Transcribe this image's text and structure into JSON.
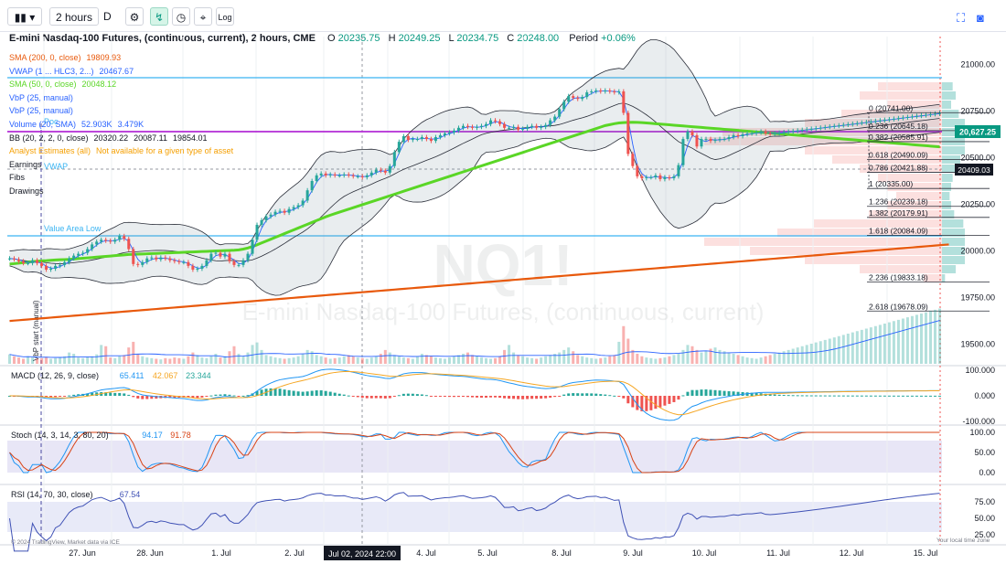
{
  "toolbar": {
    "interval": "2 hours",
    "chart_style_letter": "D",
    "log_label": "Log"
  },
  "header": {
    "title": "E-mini Nasdaq-100 Futures, (continuous, current), 2 hours, CME",
    "o_label": "O",
    "o_value": "20235.75",
    "h_label": "H",
    "h_value": "20249.25",
    "l_label": "L",
    "l_value": "20234.75",
    "c_label": "C",
    "c_value": "20248.00",
    "period_label": "Period",
    "period_change": "+0.06%"
  },
  "legend": [
    {
      "name": "SMA (200, 0, close)",
      "values": [
        "19809.93"
      ],
      "color": "#e8590c"
    },
    {
      "name": "VWAP (1 ... HLC3, 2...)",
      "values": [
        "20467.67"
      ],
      "color": "#2962ff"
    },
    {
      "name": "SMA (50, 0, close)",
      "values": [
        "20048.12"
      ],
      "color": "#5ad626"
    },
    {
      "name": "VbP (25, manual)",
      "values": [],
      "color": "#2962ff"
    },
    {
      "name": "VbP (25, manual)",
      "values": [],
      "color": "#2962ff"
    },
    {
      "name": "Volume (20, SMA)",
      "values": [
        "52.903K",
        "3.479K"
      ],
      "color": "#2962ff"
    },
    {
      "name": "BB (20, 2, 2, 0, close)",
      "values": [
        "20320.22",
        "20087.11",
        "19854.01"
      ],
      "color": "#131722"
    },
    {
      "name": "Analyst Estimates (all)",
      "values": [
        "Not available for a given type of asset"
      ],
      "color": "#f59f00"
    },
    {
      "name": "Earnings",
      "values": [],
      "color": "#131722"
    },
    {
      "name": "Fibs",
      "values": [],
      "color": "#131722"
    },
    {
      "name": "Drawings",
      "values": [],
      "color": "#131722"
    }
  ],
  "annotations": {
    "value_area_high": "Value Area High",
    "value_area_low": "Value Area Low",
    "poc": "Poc",
    "vwap_tag": "VWAP",
    "vbp_start": "VbP start (manual)",
    "watermark_symbol": "NQ1!",
    "watermark_name": "E-mini Nasdaq-100 Futures, (continuous, current)",
    "copyright": "© 2024 TradingView, Market data via ICE",
    "timezone": "Your local time zone",
    "crosshair_date": "Jul 02, 2024 22:00"
  },
  "price_tags": {
    "current": "20,627.25",
    "crosshair": "20409.03"
  },
  "colors": {
    "up": "#26a69a",
    "down": "#ef5350",
    "sma200": "#e8590c",
    "sma50": "#5ad626",
    "vwap": "#2962ff",
    "bb": "#2a2e39",
    "poc": "#b32bd4",
    "vah": "#3ab4f2",
    "macd": "#2196f3",
    "signal": "#f5a623",
    "stoch_k": "#2196f3",
    "stoch_d": "#d84315",
    "rsi": "#3f51b5"
  },
  "chart_data": [
    {
      "type": "line",
      "name": "price",
      "series_kind": "candlestick",
      "x_tick_labels": [
        "27. Jun",
        "28. Jun",
        "1. Jul",
        "2. Jul",
        "3. Jul",
        "4. Jul",
        "5. Jul",
        "8. Jul",
        "9. Jul",
        "10. Jul",
        "11. Jul",
        "12. Jul",
        "15. Jul"
      ],
      "y_tick_labels": [
        "21000.00",
        "20750.00",
        "20500.00",
        "20250.00",
        "20000.00",
        "19750.00",
        "19500.00"
      ],
      "ylim": [
        19410,
        21100
      ],
      "x": [
        0,
        1,
        2,
        3,
        4,
        5,
        6,
        7,
        8,
        9,
        10,
        11,
        12,
        13,
        14,
        15,
        16,
        17,
        18,
        19,
        20,
        21,
        22,
        23,
        24,
        25,
        26,
        27,
        28,
        29,
        30,
        31,
        32,
        33,
        34,
        35,
        36,
        37,
        38,
        39,
        40,
        41,
        42,
        43,
        44,
        45,
        46,
        47,
        48,
        49,
        50,
        51,
        52,
        53,
        54,
        55,
        56,
        57,
        58,
        59,
        60,
        61,
        62,
        63,
        64,
        65,
        66,
        67,
        68,
        69,
        70,
        71,
        72,
        73,
        74,
        75,
        76,
        77,
        78,
        79,
        80,
        81,
        82,
        83,
        84,
        85,
        86,
        87,
        88,
        89,
        90,
        91,
        92,
        93,
        94,
        95,
        96,
        97,
        98,
        99,
        100,
        101,
        102,
        103,
        104,
        105,
        106,
        107,
        108,
        109,
        110,
        111,
        112,
        113,
        114,
        115,
        116,
        117,
        118,
        119,
        120,
        121,
        122,
        123,
        124,
        125,
        126,
        127,
        128,
        129,
        130,
        131,
        132,
        133,
        134,
        135,
        136,
        137,
        138,
        139,
        140,
        141,
        142,
        143,
        144,
        145,
        146,
        147,
        148,
        149,
        150,
        151,
        152,
        153,
        154,
        155,
        156,
        157,
        158,
        159,
        160,
        161,
        162,
        163,
        164,
        165,
        166,
        167,
        168,
        169,
        170,
        171,
        172,
        173,
        174,
        175,
        176,
        177,
        178,
        179,
        180,
        181,
        182,
        183,
        184,
        185,
        186,
        187,
        188,
        189,
        190,
        191,
        192,
        193,
        194,
        195,
        196,
        197,
        198,
        199,
        200,
        201,
        202,
        203,
        204,
        205
      ],
      "close": [
        19960,
        19955,
        19945,
        19935,
        19935,
        19950,
        19935,
        19920,
        19900,
        19905,
        19920,
        19925,
        19940,
        19960,
        19975,
        19985,
        19990,
        20010,
        20035,
        20050,
        20060,
        20055,
        20050,
        20060,
        20080,
        20065,
        20010,
        19930,
        19925,
        19940,
        19960,
        19965,
        19955,
        19965,
        19960,
        19950,
        19945,
        19940,
        19940,
        19920,
        19900,
        19905,
        19920,
        19950,
        19985,
        19990,
        19970,
        19985,
        19945,
        19925,
        19925,
        19950,
        19985,
        20060,
        20140,
        20165,
        20185,
        20195,
        20210,
        20215,
        20205,
        20225,
        20235,
        20245,
        20270,
        20325,
        20375,
        20405,
        20415,
        20405,
        20410,
        20405,
        20405,
        20410,
        20405,
        20400,
        20400,
        20395,
        20405,
        20420,
        20435,
        20430,
        20420,
        20455,
        20530,
        20585,
        20615,
        20595,
        20600,
        20600,
        20610,
        20600,
        20590,
        20610,
        20620,
        20630,
        20635,
        20645,
        20660,
        20670,
        20665,
        20660,
        20665,
        20670,
        20680,
        20700,
        20695,
        20680,
        20660,
        20660,
        20665,
        20650,
        20655,
        20665,
        20670,
        20660,
        20665,
        20675,
        20700,
        20720,
        20760,
        20800,
        20830,
        20820,
        20815,
        20825,
        20850,
        20855,
        20860,
        20855,
        20860,
        20855,
        20850,
        20855,
        20740,
        20520,
        20455,
        20400,
        20390,
        20395,
        20395,
        20405,
        20385,
        20395,
        20390,
        20400,
        20460,
        20600,
        20640,
        20620,
        20560,
        20600,
        20600,
        20590,
        20595,
        20600,
        20600,
        20610,
        20620,
        20615,
        20625,
        20630,
        20630,
        20635,
        20640,
        20630,
        20628,
        20631,
        20634,
        20637,
        20640,
        20643,
        20646,
        20649,
        20652,
        20655,
        20658,
        20661,
        20664,
        20667,
        20670,
        20673,
        20676,
        20679,
        20682,
        20685,
        20688,
        20691,
        20694,
        20697,
        20700,
        20703,
        20706,
        20709,
        20712,
        20715,
        20718,
        20721,
        20724,
        20727,
        20730,
        20733,
        20736,
        20739
      ],
      "sma50": [
        19930,
        19932,
        19935,
        19938,
        19940,
        19943,
        19945,
        19947,
        19948,
        19950,
        19952,
        19953,
        19954,
        19955,
        19957,
        19959,
        19961,
        19963,
        19965,
        19967,
        19969,
        19971,
        19973,
        19975,
        19977,
        19979,
        19981,
        19982,
        19983,
        19984,
        19985,
        19986,
        19987,
        19988,
        19989,
        19990,
        19991,
        19992,
        19993,
        19994,
        19995,
        19996,
        19997,
        19998,
        19999,
        20000,
        20001,
        20002,
        20003,
        20004,
        20006,
        20010,
        20016,
        20024,
        20033,
        20043,
        20053,
        20063,
        20073,
        20083,
        20093,
        20103,
        20113,
        20123,
        20133,
        20143,
        20153,
        20163,
        20173,
        20183,
        20192,
        20200,
        20208,
        20216,
        20224,
        20232,
        20240,
        20248,
        20256,
        20264,
        20272,
        20280,
        20288,
        20296,
        20304,
        20312,
        20320,
        20328,
        20336,
        20344,
        20352,
        20360,
        20368,
        20376,
        20384,
        20392,
        20400,
        20408,
        20416,
        20424,
        20432,
        20440,
        20448,
        20456,
        20464,
        20472,
        20480,
        20488,
        20496,
        20504,
        20512,
        20520,
        20528,
        20536,
        20544,
        20552,
        20560,
        20568,
        20576,
        20584,
        20592,
        20600,
        20608,
        20616,
        20624,
        20632,
        20640,
        20648,
        20656,
        20664,
        20672,
        20677,
        20682,
        20686,
        20688,
        20689,
        20690,
        20689,
        20688,
        20686,
        20684,
        20682,
        20680,
        20678,
        20676,
        20674,
        20672,
        20670,
        20668,
        20666,
        20664,
        20662,
        20660,
        20658,
        20656,
        20654,
        20652,
        20650,
        20648,
        20646,
        20644,
        20642,
        20640,
        20638,
        20636,
        20634,
        20632,
        20630,
        20628,
        20626,
        20624,
        20622,
        20620,
        20618,
        20616,
        20614,
        20612,
        20610,
        20608,
        20606,
        20604,
        20602,
        20600,
        20598,
        20596,
        20594,
        20592,
        20590,
        20588,
        20586,
        20584,
        20582,
        20580,
        20578,
        20576,
        20574,
        20572,
        20570,
        20568,
        20566,
        20564,
        20562,
        20560,
        20558
      ],
      "sma200": [
        19625,
        19627,
        19629,
        19631,
        19633,
        19635,
        19637,
        19639,
        19641,
        19643,
        19645,
        19647,
        19649,
        19651,
        19653,
        19655,
        19657,
        19659,
        19661,
        19663,
        19665,
        19667,
        19669,
        19671,
        19673,
        19675,
        19677,
        19679,
        19681,
        19683,
        19685,
        19687,
        19689,
        19691,
        19693,
        19695,
        19697,
        19699,
        19701,
        19703,
        19705,
        19707,
        19709,
        19711,
        19713,
        19715,
        19717,
        19719,
        19721,
        19723,
        19725,
        19727,
        19729,
        19731,
        19733,
        19735,
        19737,
        19739,
        19741,
        19743,
        19745,
        19747,
        19749,
        19751,
        19753,
        19755,
        19757,
        19759,
        19761,
        19763,
        19765,
        19767,
        19769,
        19771,
        19773,
        19775,
        19777,
        19779,
        19781,
        19783,
        19785,
        19787,
        19789,
        19791,
        19793,
        19795,
        19797,
        19799,
        19801,
        19803,
        19805,
        19807,
        19809,
        19811,
        19813,
        19815,
        19817,
        19819,
        19821,
        19823,
        19825,
        19827,
        19829,
        19831,
        19833,
        19835,
        19837,
        19839,
        19841,
        19843,
        19845,
        19847,
        19849,
        19851,
        19853,
        19855,
        19857,
        19859,
        19861,
        19863,
        19865,
        19867,
        19869,
        19871,
        19873,
        19875,
        19877,
        19879,
        19881,
        19883,
        19885,
        19887,
        19889,
        19891,
        19893,
        19895,
        19897,
        19899,
        19901,
        19903,
        19905,
        19907,
        19909,
        19911,
        19913,
        19915,
        19917,
        19919,
        19921,
        19923,
        19925,
        19927,
        19929,
        19931,
        19933,
        19935,
        19937,
        19939,
        19941,
        19943,
        19945,
        19947,
        19949,
        19951,
        19953,
        19955,
        19957,
        19959,
        19961,
        19963,
        19965,
        19967,
        19969,
        19971,
        19973,
        19975,
        19977,
        19979,
        19981,
        19983,
        19985,
        19987,
        19989,
        19991,
        19993,
        19995,
        19997,
        19999,
        20001,
        20003,
        20005,
        20007,
        20009,
        20011,
        20013,
        20015,
        20017,
        20019,
        20021,
        20023,
        20025,
        20027,
        20029,
        20031,
        20033,
        20035
      ]
    },
    {
      "type": "table",
      "name": "fibonacci_levels",
      "levels": [
        {
          "ratio": "0",
          "price": "20741.00"
        },
        {
          "ratio": "0.236",
          "price": "20645.18"
        },
        {
          "ratio": "0.382",
          "price": "20585.91"
        },
        {
          "ratio": "0.618",
          "price": "20490.09"
        },
        {
          "ratio": "0.786",
          "price": "20421.88"
        },
        {
          "ratio": "1",
          "price": "20335.00"
        },
        {
          "ratio": "1.236",
          "price": "20239.18"
        },
        {
          "ratio": "1.382",
          "price": "20179.91"
        },
        {
          "ratio": "1.618",
          "price": "20084.09"
        },
        {
          "ratio": "2.236",
          "price": "19833.18"
        },
        {
          "ratio": "2.618",
          "price": "19678.09"
        }
      ]
    },
    {
      "type": "bar",
      "name": "volume",
      "values": [
        15,
        12,
        10,
        8,
        12,
        10,
        8,
        9,
        11,
        8,
        9,
        10,
        12,
        18,
        16,
        10,
        9,
        11,
        12,
        15,
        30,
        28,
        10,
        9,
        12,
        14,
        26,
        35,
        15,
        12,
        10,
        9,
        8,
        7,
        9,
        8,
        10,
        9,
        8,
        12,
        18,
        14,
        10,
        9,
        12,
        16,
        10,
        12,
        20,
        28,
        16,
        12,
        18,
        30,
        34,
        22,
        14,
        12,
        10,
        9,
        8,
        9,
        10,
        12,
        16,
        22,
        20,
        14,
        12,
        10,
        8,
        9,
        10,
        12,
        14,
        12,
        10,
        9,
        8,
        10,
        12,
        16,
        22,
        18,
        14,
        12,
        10,
        9,
        8,
        12,
        16,
        14,
        12,
        10,
        9,
        8,
        10,
        12,
        14,
        16,
        18,
        14,
        12,
        10,
        9,
        8,
        9,
        12,
        22,
        30,
        18,
        14,
        12,
        10,
        9,
        8,
        10,
        12,
        14,
        16,
        18,
        22,
        26,
        20,
        14,
        12,
        10,
        9,
        8,
        9,
        10,
        12,
        14,
        35,
        60,
        40,
        22,
        16,
        12,
        10,
        9,
        8,
        9,
        10,
        12,
        14,
        16,
        22,
        30,
        28,
        22,
        18,
        20,
        24,
        26,
        22,
        20,
        18,
        16,
        14,
        12,
        10,
        9,
        8,
        10,
        12,
        14,
        16,
        18,
        20,
        22,
        24,
        26,
        28,
        30,
        32,
        34,
        36,
        38,
        40,
        42,
        44,
        46,
        48,
        50,
        52,
        54,
        56,
        58,
        60,
        62,
        64,
        66,
        68,
        70,
        72,
        74,
        76,
        78,
        80,
        82,
        84,
        86,
        88
      ],
      "ylim": [
        0,
        80
      ]
    },
    {
      "type": "line",
      "name": "MACD (12, 26, 9, close)",
      "values_text": [
        "65.411",
        "42.067",
        "23.344"
      ],
      "y_tick_labels": [
        "100.000",
        "0.000",
        "-100.000"
      ],
      "ylim": [
        -115,
        115
      ]
    },
    {
      "type": "line",
      "name": "Stoch (14, 3, 14, 3, 80, 20)",
      "values_text": [
        "94.17",
        "91.78"
      ],
      "y_tick_labels": [
        "100.00",
        "50.00",
        "0.00"
      ],
      "ylim": [
        -5,
        105
      ]
    },
    {
      "type": "line",
      "name": "RSI (14, 70, 30, close)",
      "values_text": [
        "67.54"
      ],
      "y_tick_labels": [
        "75.00",
        "50.00",
        "25.00"
      ],
      "ylim": [
        18,
        85
      ]
    }
  ]
}
